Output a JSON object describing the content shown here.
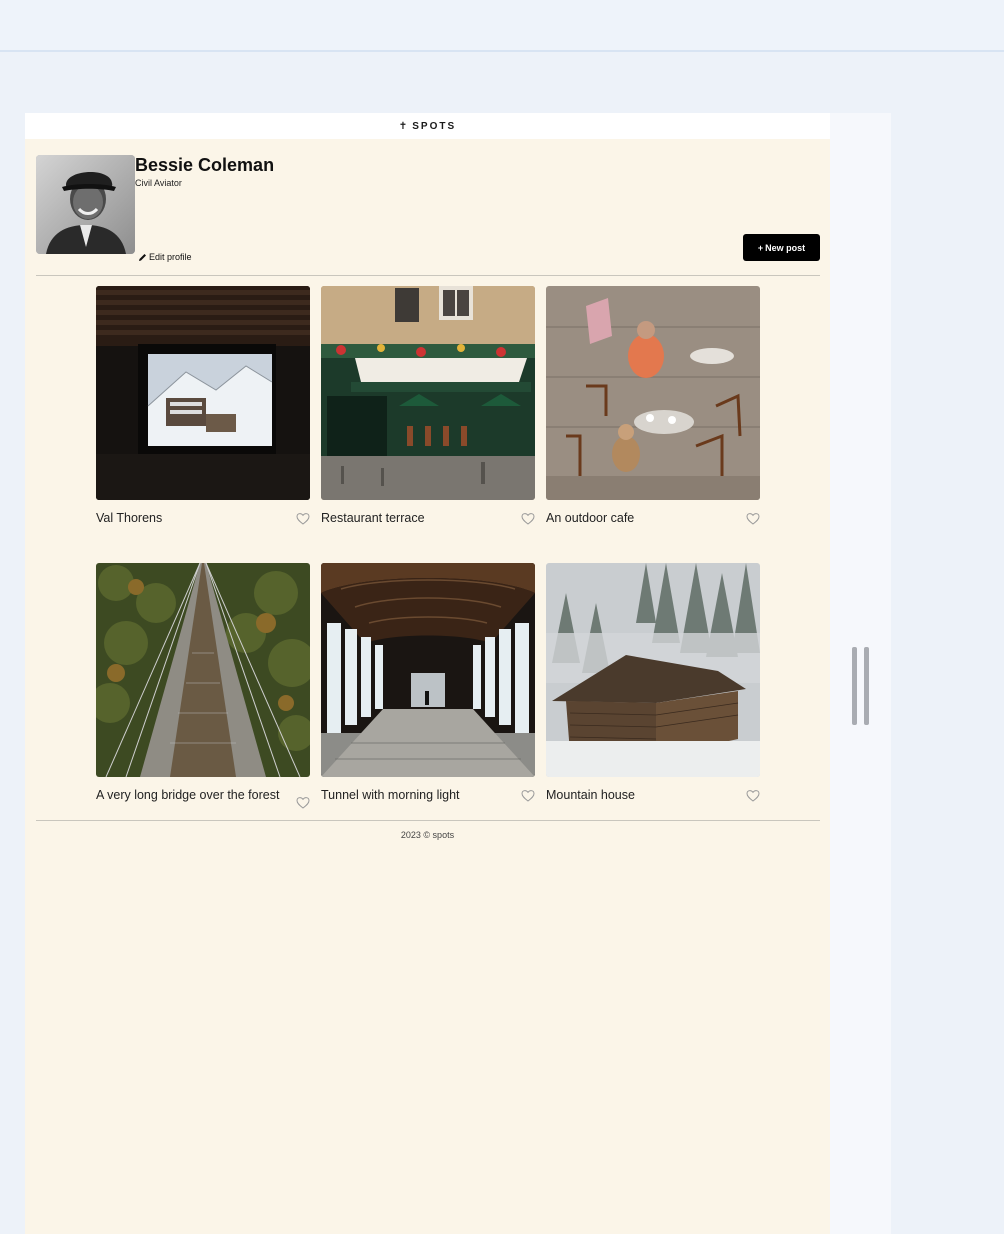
{
  "header": {
    "logo_text": "SPOTS",
    "logo_mark": "✝"
  },
  "profile": {
    "name": "Bessie Coleman",
    "description": "Civil Aviator",
    "edit_label": "Edit profile",
    "avatar_icon": "portrait"
  },
  "actions": {
    "new_post_label": "New post",
    "new_post_icon": "+"
  },
  "cards": [
    {
      "title": "Val Thorens",
      "image": "window-snow-village"
    },
    {
      "title": "Restaurant terrace",
      "image": "cafe-storefront"
    },
    {
      "title": "An outdoor cafe",
      "image": "outdoor-cafe-tables"
    },
    {
      "title": "A very long bridge over the forest",
      "image": "suspension-bridge-forest"
    },
    {
      "title": "Tunnel with morning light",
      "image": "glass-tunnel"
    },
    {
      "title": "Mountain house",
      "image": "snowy-cabin"
    }
  ],
  "footer": {
    "text": "2023 © spots"
  },
  "colors": {
    "page_bg": "#fbf5e8",
    "accent": "#000000",
    "outer_bg": "#edf2f9"
  }
}
